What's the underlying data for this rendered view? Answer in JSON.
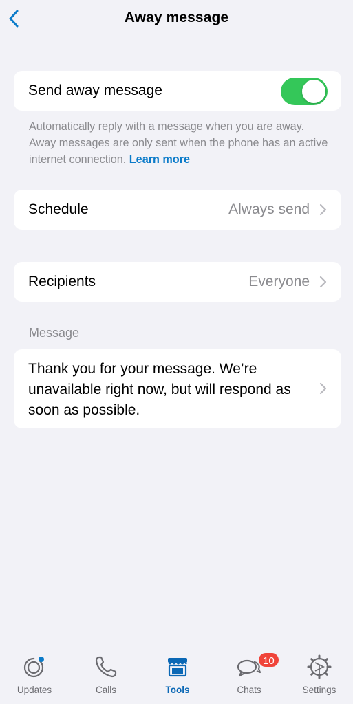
{
  "header": {
    "title": "Away message",
    "back_icon": "chevron-left-icon"
  },
  "away_toggle": {
    "label": "Send away message",
    "enabled": true,
    "on_color": "#34c759"
  },
  "description": {
    "text": "Automatically reply with a message when you are away. Away messages are only sent when the phone has an active internet connection. ",
    "link": "Learn more",
    "link_color": "#0b7bc9"
  },
  "schedule": {
    "label": "Schedule",
    "value": "Always send"
  },
  "recipients": {
    "label": "Recipients",
    "value": "Everyone"
  },
  "message_section": {
    "label": "Message",
    "text": "Thank you for your message. We’re unavailable right now, but will respond as soon as possible."
  },
  "tabbar": {
    "active_color": "#0b68b5",
    "tabs": [
      {
        "label": "Updates",
        "icon": "updates-icon"
      },
      {
        "label": "Calls",
        "icon": "phone-icon"
      },
      {
        "label": "Tools",
        "icon": "storefront-icon",
        "active": true
      },
      {
        "label": "Chats",
        "icon": "chat-bubbles-icon",
        "badge": "10"
      },
      {
        "label": "Settings",
        "icon": "gear-icon"
      }
    ]
  }
}
